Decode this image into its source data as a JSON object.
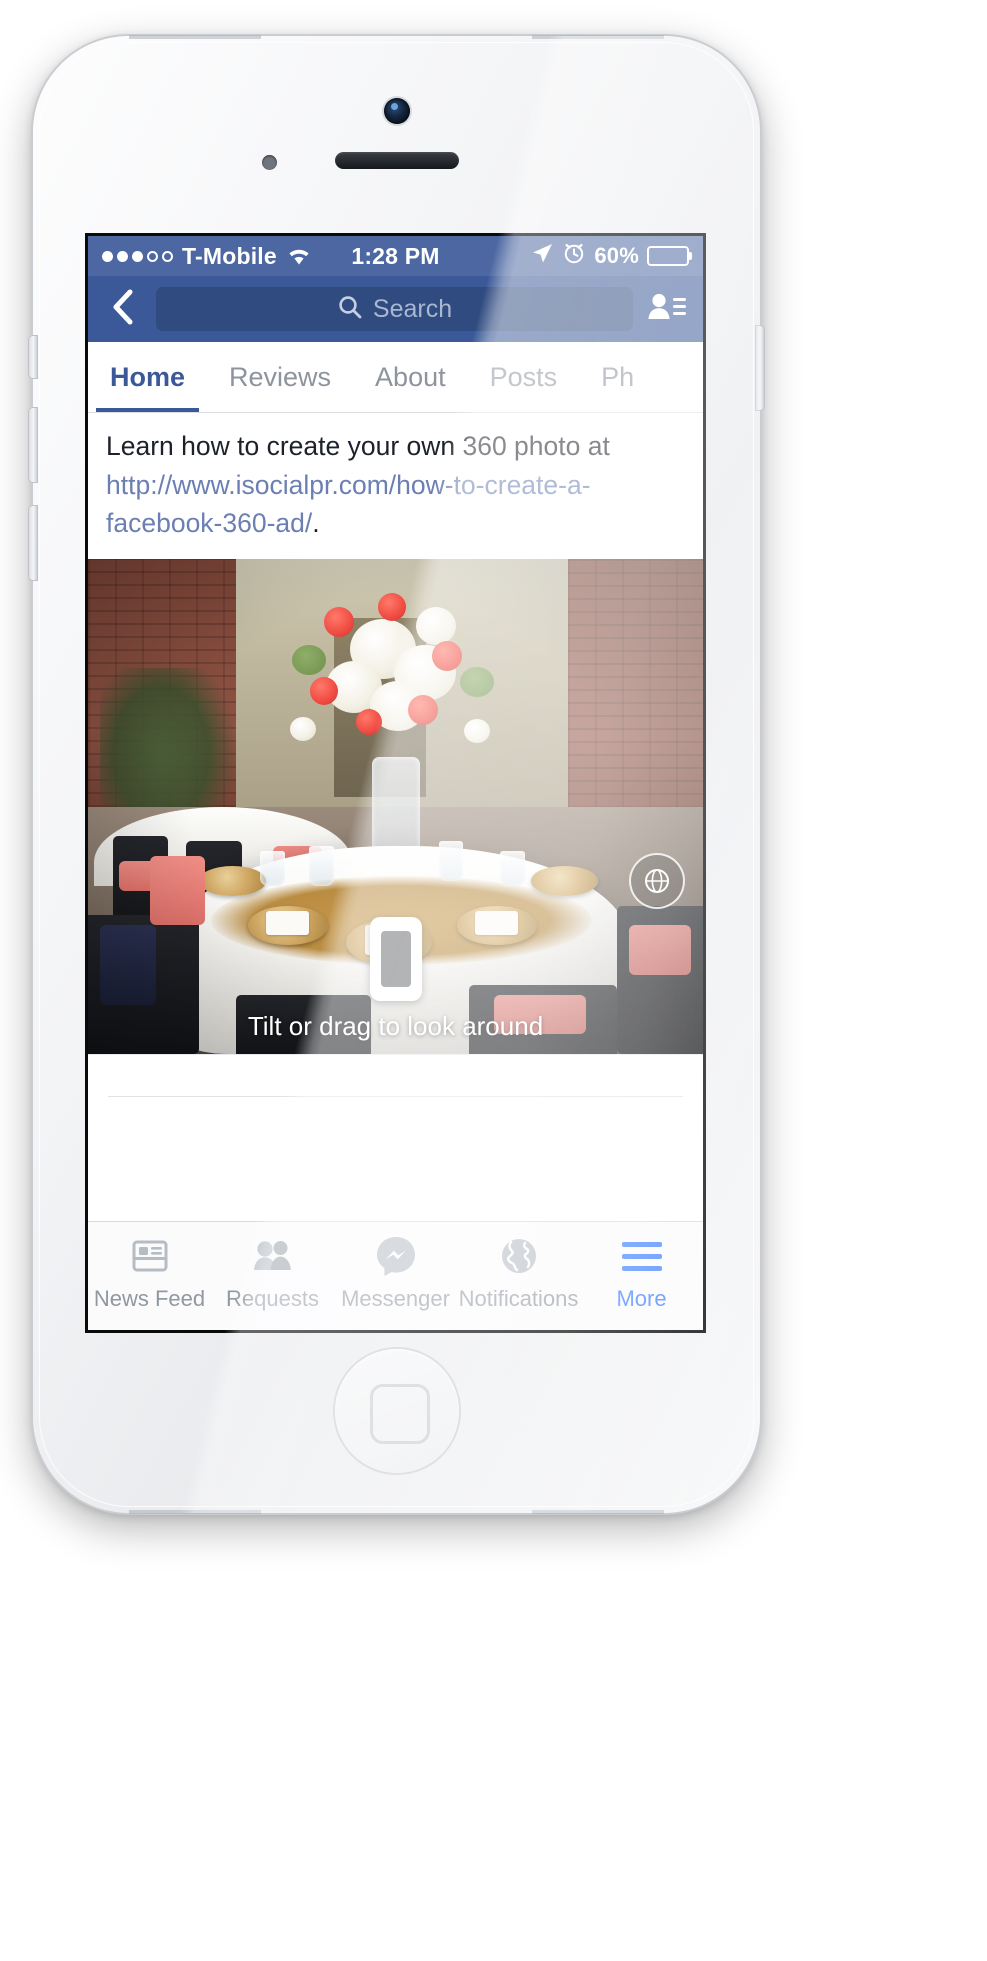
{
  "status_bar": {
    "signal_dots_filled": 3,
    "signal_dots_total": 5,
    "carrier": "T-Mobile",
    "wifi_icon": "wifi-icon",
    "time": "1:28 PM",
    "location_icon": "location-arrow-icon",
    "alarm_icon": "alarm-clock-icon",
    "battery_percent": "60%",
    "battery_level": 60
  },
  "nav_bar": {
    "back_icon": "chevron-left-icon",
    "search_icon": "search-icon",
    "search_placeholder": "Search",
    "search_value": "",
    "friend_requests_icon": "friend-requests-icon"
  },
  "page_tabs": {
    "items": [
      {
        "label": "Home",
        "active": true
      },
      {
        "label": "Reviews",
        "active": false
      },
      {
        "label": "About",
        "active": false
      },
      {
        "label": "Posts",
        "active": false
      },
      {
        "label": "Ph",
        "active": false
      }
    ]
  },
  "post": {
    "text_before_link": "Learn how to create your own 360 photo at ",
    "link_text": "http://www.isocialpr.com/how-to-create-a-facebook-360-ad/",
    "text_after_link": ".",
    "photo": {
      "type": "360-photo",
      "badge_icon": "360-sphere-icon",
      "tilt_icon": "tilt-phone-icon",
      "hint": "Tilt or drag to look around",
      "alt": "Banquet hall round table set with white linens, gold charger plates, black folding chairs with coral and navy sashes, and a tall coral-and-white floral centerpiece in front of a brick wall."
    }
  },
  "bottom_tabs": {
    "items": [
      {
        "label": "News Feed",
        "icon": "news-feed-icon",
        "active": false
      },
      {
        "label": "Requests",
        "icon": "friend-requests-icon",
        "active": false
      },
      {
        "label": "Messenger",
        "icon": "messenger-icon",
        "active": false
      },
      {
        "label": "Notifications",
        "icon": "globe-icon",
        "active": false
      },
      {
        "label": "More",
        "icon": "hamburger-menu-icon",
        "active": true
      }
    ]
  },
  "colors": {
    "facebook_blue": "#3b5998",
    "status_bar_blue": "#4c67a1",
    "search_field": "#2f4b80",
    "active_tab_blue": "#4080ff",
    "link_blue": "#6b7fb3",
    "inactive_gray": "#9198a1"
  }
}
